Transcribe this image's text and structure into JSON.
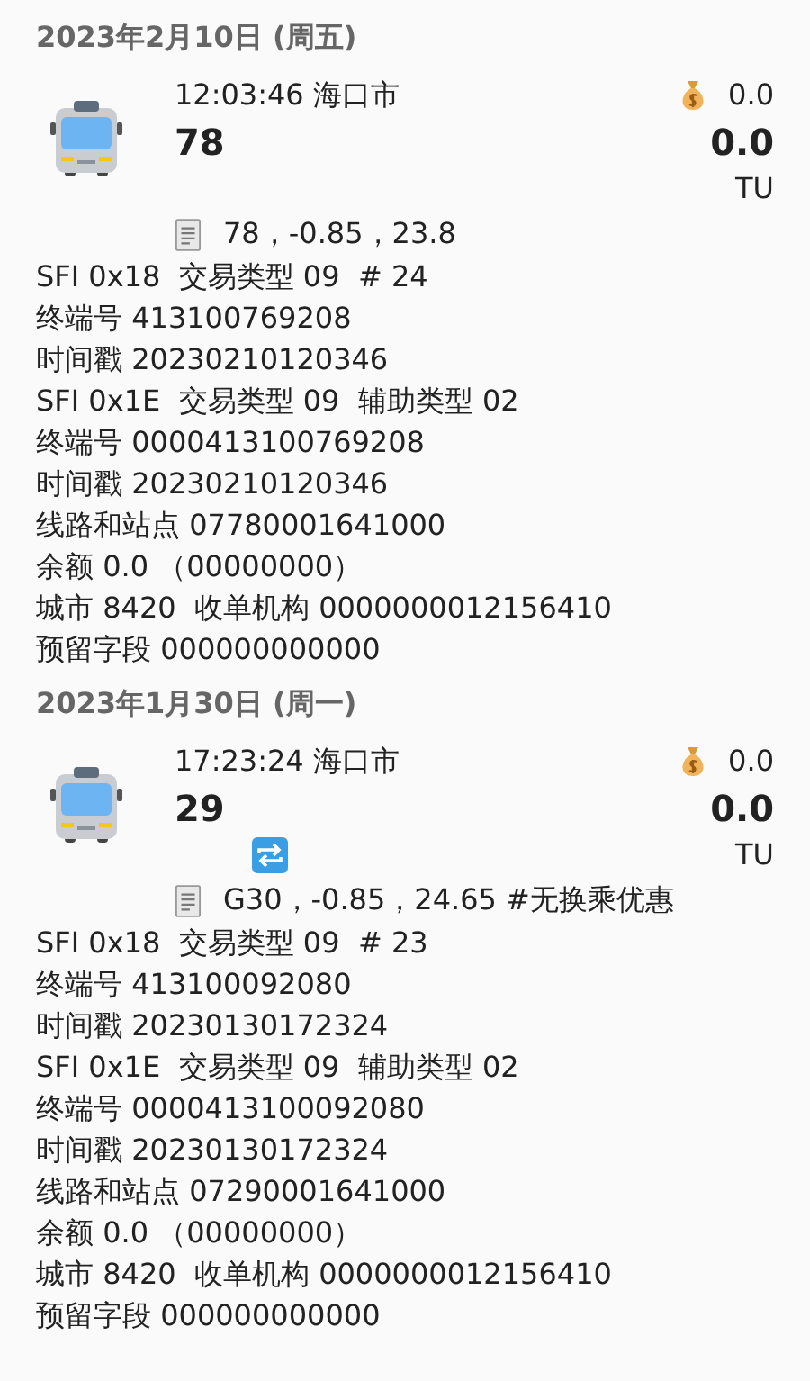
{
  "records": [
    {
      "date": "2023年2月10日 (周五)",
      "time": "12:03:46",
      "city": "海口市",
      "balance": "0.0",
      "route": "78",
      "amount": "0.0",
      "unit": "TU",
      "transfer": false,
      "memo": "78，-0.85，23.8",
      "details": [
        "SFI 0x18  交易类型 09  # 24",
        "终端号 413100769208",
        "时间戳 20230210120346",
        "SFI 0x1E  交易类型 09  辅助类型 02",
        "终端号 0000413100769208",
        "时间戳 20230210120346",
        "线路和站点 07780001641000",
        "余额 0.0 （00000000）",
        "城市 8420  收单机构 0000000012156410",
        "预留字段 000000000000"
      ]
    },
    {
      "date": "2023年1月30日 (周一)",
      "time": "17:23:24",
      "city": "海口市",
      "balance": "0.0",
      "route": "29",
      "amount": "0.0",
      "unit": "TU",
      "transfer": true,
      "memo": "G30，-0.85，24.65 #无换乘优惠",
      "details": [
        "SFI 0x18  交易类型 09  # 23",
        "终端号 413100092080",
        "时间戳 20230130172324",
        "SFI 0x1E  交易类型 09  辅助类型 02",
        "终端号 0000413100092080",
        "时间戳 20230130172324",
        "线路和站点 07290001641000",
        "余额 0.0 （00000000）",
        "城市 8420  收单机构 0000000012156410",
        "预留字段 000000000000"
      ]
    }
  ]
}
